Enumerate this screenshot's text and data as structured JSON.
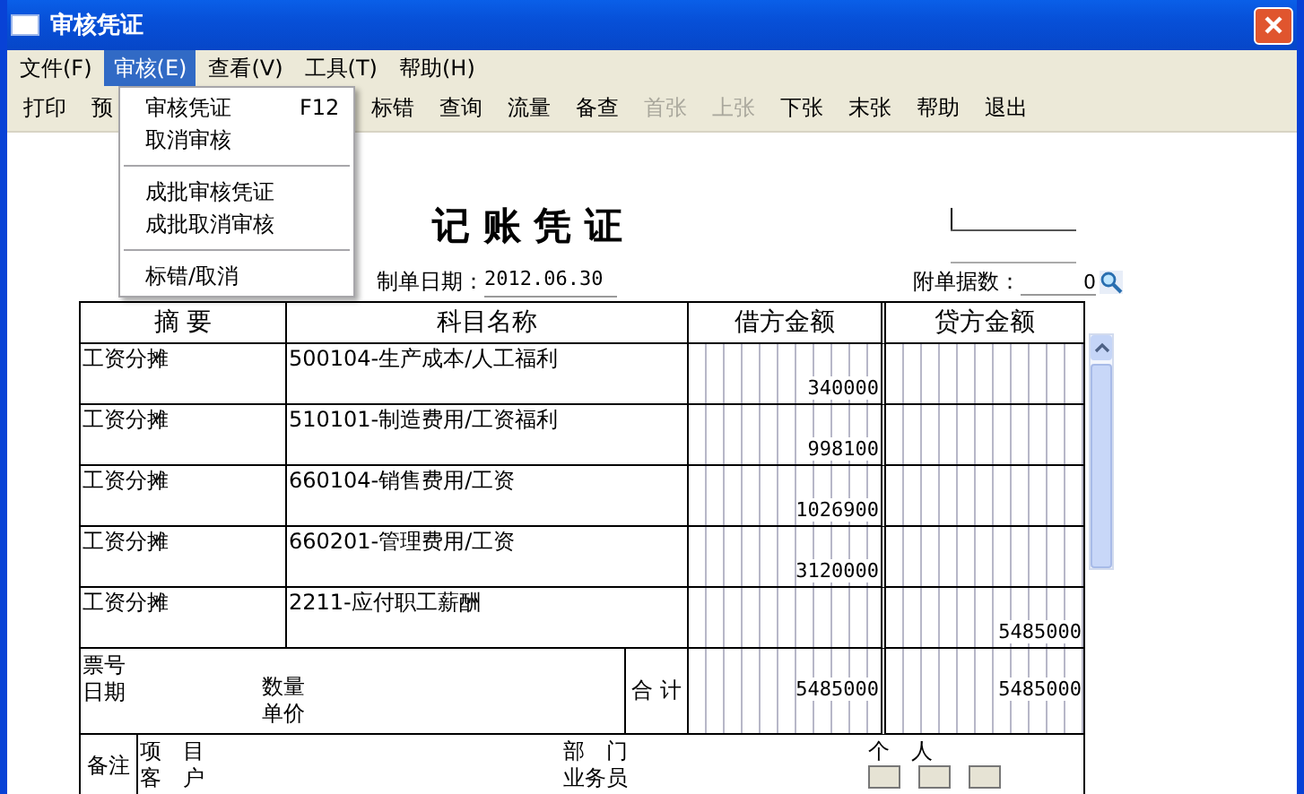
{
  "window": {
    "title": "审核凭证"
  },
  "menu_bar": [
    {
      "label": "文件(F)",
      "selected": false
    },
    {
      "label": "审核(E)",
      "selected": true
    },
    {
      "label": "查看(V)",
      "selected": false
    },
    {
      "label": "工具(T)",
      "selected": false
    },
    {
      "label": "帮助(H)",
      "selected": false
    }
  ],
  "toolbar": [
    {
      "label": "打印",
      "disabled": false
    },
    {
      "label": "预",
      "disabled": false
    },
    {
      "label": "标错",
      "disabled": false
    },
    {
      "label": "查询",
      "disabled": false
    },
    {
      "label": "流量",
      "disabled": false
    },
    {
      "label": "备查",
      "disabled": false
    },
    {
      "label": "首张",
      "disabled": true
    },
    {
      "label": "上张",
      "disabled": true
    },
    {
      "label": "下张",
      "disabled": false
    },
    {
      "label": "末张",
      "disabled": false
    },
    {
      "label": "帮助",
      "disabled": false
    },
    {
      "label": "退出",
      "disabled": false
    }
  ],
  "dropdown": {
    "items": [
      {
        "kind": "item",
        "label": "审核凭证",
        "shortcut": "F12"
      },
      {
        "kind": "item",
        "label": "取消审核"
      },
      {
        "kind": "separator"
      },
      {
        "kind": "item",
        "label": "成批审核凭证"
      },
      {
        "kind": "item",
        "label": "成批取消审核"
      },
      {
        "kind": "separator"
      },
      {
        "kind": "item",
        "label": "标错/取消"
      }
    ]
  },
  "voucher": {
    "title": "记 账 凭 证",
    "date_label": "制单日期：",
    "date": "2012.06.30",
    "attachments_label": "附单据数：",
    "attachments": "0",
    "columns": [
      "摘 要",
      "科目名称",
      "借方金额",
      "贷方金额"
    ],
    "rows": [
      {
        "summary": "工资分摊",
        "account": "500104-生产成本/人工福利",
        "debit": "340000",
        "credit": ""
      },
      {
        "summary": "工资分摊",
        "account": "510101-制造费用/工资福利",
        "debit": "998100",
        "credit": ""
      },
      {
        "summary": "工资分摊",
        "account": "660104-销售费用/工资",
        "debit": "1026900",
        "credit": ""
      },
      {
        "summary": "工资分摊",
        "account": "660201-管理费用/工资",
        "debit": "3120000",
        "credit": ""
      },
      {
        "summary": "工资分摊",
        "account": "2211-应付职工薪酬",
        "debit": "",
        "credit": "5485000"
      }
    ],
    "totals": {
      "ticket_label": "票号",
      "date_label": "日期",
      "quantity_label": "数量",
      "price_label": "单价",
      "total_label": "合 计",
      "debit": "5485000",
      "credit": "5485000"
    },
    "notes": {
      "label": "备注",
      "project_label": "项　目",
      "customer_label": "客　户",
      "department_label": "部　门",
      "salesperson_label": "业务员",
      "person_label": "个　人"
    }
  }
}
